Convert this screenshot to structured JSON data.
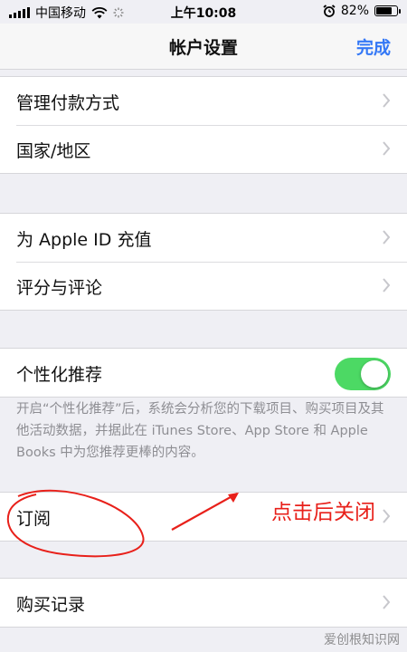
{
  "status_bar": {
    "carrier": "中国移动",
    "time": "上午10:08",
    "battery": "82%",
    "battery_level": 0.82
  },
  "nav": {
    "title": "帐户设置",
    "done": "完成"
  },
  "groups": [
    {
      "items": [
        {
          "label": "管理付款方式"
        },
        {
          "label": "国家/地区"
        }
      ]
    },
    {
      "items": [
        {
          "label": "为 Apple ID 充值"
        },
        {
          "label": "评分与评论"
        }
      ]
    },
    {
      "items": [
        {
          "label": "个性化推荐",
          "toggle": true
        }
      ]
    },
    {
      "items": [
        {
          "label": "订阅"
        }
      ]
    },
    {
      "items": [
        {
          "label": "购买记录"
        }
      ]
    }
  ],
  "personalization_footnote": "开启“个性化推荐”后，系统会分析您的下载项目、购买项目及其他活动数据，并据此在 iTunes Store、App Store 和 Apple Books 中为您推荐更棒的内容。",
  "annotation": {
    "text": "点击后关闭",
    "color": "#e8201a"
  },
  "watermark": "爱创根知识网",
  "colors": {
    "accent": "#3478f6",
    "toggle_on": "#4cd964",
    "background": "#efeff4"
  }
}
